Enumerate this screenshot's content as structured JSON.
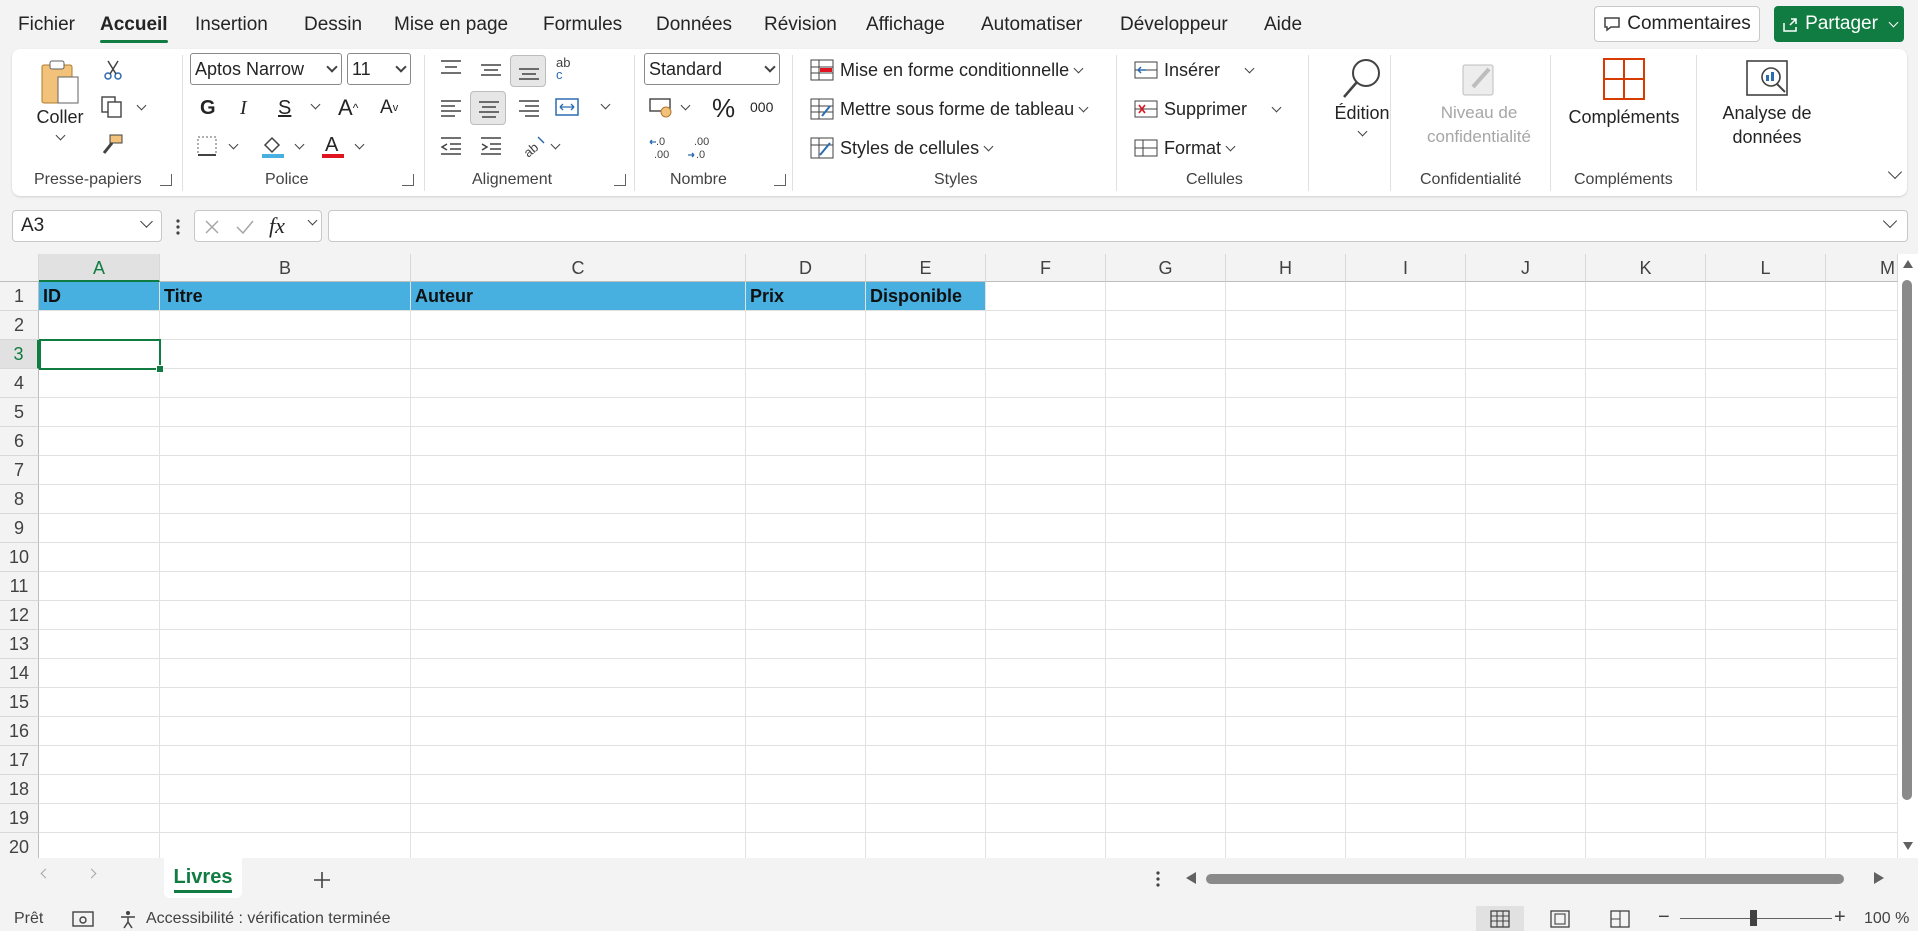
{
  "menu": {
    "items": [
      "Fichier",
      "Accueil",
      "Insertion",
      "Dessin",
      "Mise en page",
      "Formules",
      "Données",
      "Révision",
      "Affichage",
      "Automatiser",
      "Développeur",
      "Aide"
    ],
    "comments_label": "Commentaires",
    "share_label": "Partager"
  },
  "ribbon": {
    "groups": {
      "clipboard": {
        "label": "Presse-papiers",
        "paste_label": "Coller"
      },
      "font": {
        "label": "Police",
        "font_name": "Aptos Narrow",
        "font_size": "11",
        "bold": "G",
        "italic": "I",
        "strike": "S"
      },
      "alignment": {
        "label": "Alignement"
      },
      "number": {
        "label": "Nombre",
        "format": "Standard",
        "percent": "%",
        "thousands": "000"
      },
      "styles": {
        "label": "Styles",
        "conditional": "Mise en forme conditionnelle",
        "as_table": "Mettre sous forme de tableau",
        "cell_styles": "Styles de cellules"
      },
      "cells": {
        "label": "Cellules",
        "insert": "Insérer",
        "delete": "Supprimer",
        "format": "Format"
      },
      "editing": {
        "label": "Édition"
      },
      "sensitivity": {
        "label": "Confidentialité",
        "btn_line1": "Niveau de",
        "btn_line2": "confidentialité"
      },
      "addins": {
        "label": "Compléments",
        "btn": "Compléments"
      },
      "analyze": {
        "btn_line1": "Analyse de",
        "btn_line2": "données"
      }
    }
  },
  "formula_bar": {
    "name_box": "A3",
    "formula": ""
  },
  "sheet": {
    "columns": [
      "A",
      "B",
      "C",
      "D",
      "E",
      "F",
      "G",
      "H",
      "I",
      "J",
      "K",
      "L",
      "M"
    ],
    "rows": [
      "1",
      "2",
      "3",
      "4",
      "5",
      "6",
      "7",
      "8",
      "9",
      "10",
      "11",
      "12",
      "13",
      "14",
      "15",
      "16",
      "17",
      "18",
      "19",
      "20"
    ],
    "header_row": [
      "ID",
      "Titre",
      "Auteur",
      "Prix",
      "Disponible"
    ],
    "header_color": "#47b0e0",
    "selected_cell": "A3"
  },
  "tabs": {
    "sheet_name": "Livres"
  },
  "status": {
    "ready": "Prêt",
    "accessibility": "Accessibilité : vérification terminée",
    "zoom": "100 %"
  },
  "colors": {
    "accent": "#107c41"
  }
}
